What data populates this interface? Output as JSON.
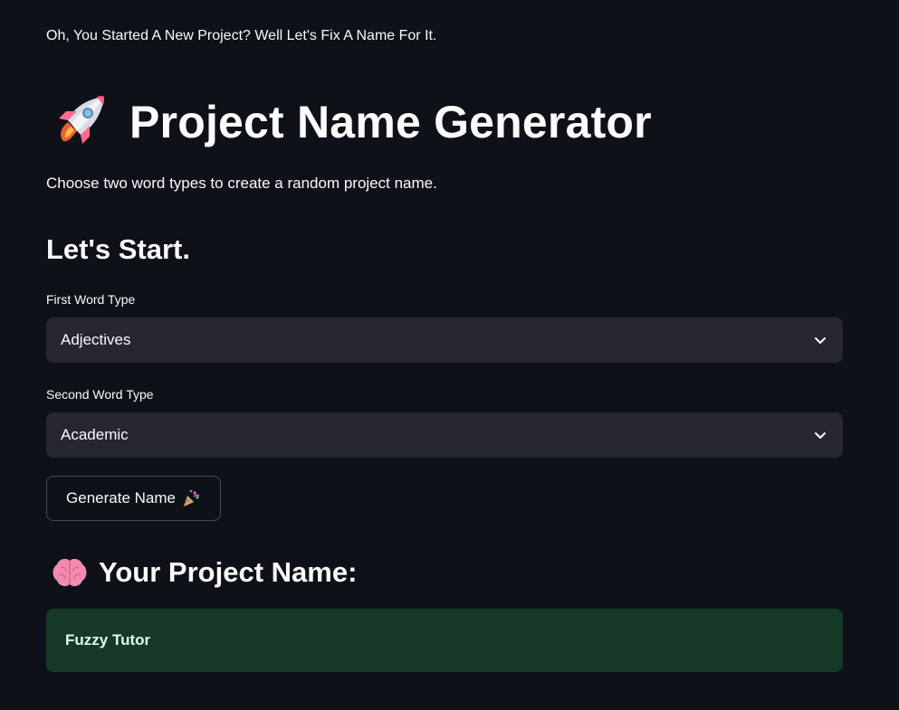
{
  "intro_text": "Oh, You Started A New Project? Well Let's Fix A Name For It.",
  "title": {
    "icon": "rocket-icon",
    "text": "Project Name Generator"
  },
  "subtitle": "Choose two word types to create a random project name.",
  "section_heading": "Let's Start.",
  "first_word": {
    "label": "First Word Type",
    "value": "Adjectives",
    "icon": "chevron-down-icon"
  },
  "second_word": {
    "label": "Second Word Type",
    "value": "Academic",
    "icon": "chevron-down-icon"
  },
  "generate_button": {
    "label": "Generate Name",
    "icon": "party-popper-icon"
  },
  "result": {
    "heading_icon": "brain-icon",
    "heading": "Your Project Name:",
    "value": "Fuzzy Tutor"
  },
  "colors": {
    "background": "#0e1117",
    "select_background": "#262730",
    "result_background": "#173928",
    "text": "#fafafa",
    "result_text": "#dffde9"
  }
}
